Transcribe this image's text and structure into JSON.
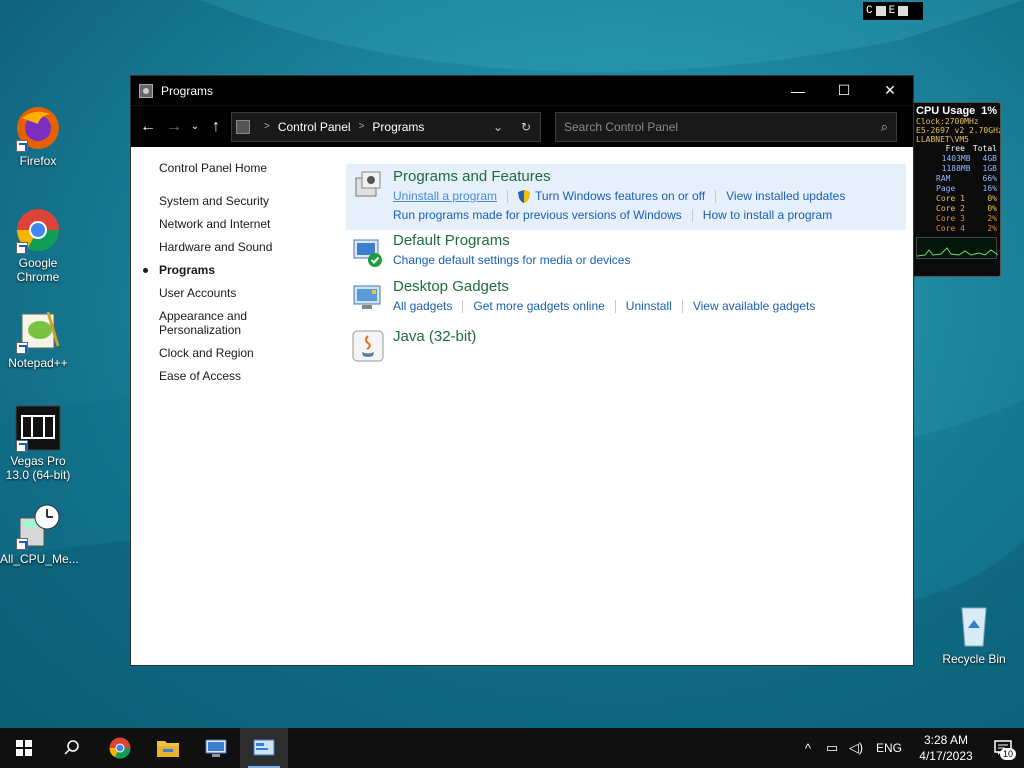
{
  "desktop": {
    "icons": [
      {
        "label": "Firefox"
      },
      {
        "label": "Google Chrome"
      },
      {
        "label": "Notepad++"
      },
      {
        "label": "Vegas Pro 13.0 (64-bit)"
      },
      {
        "label": "All_CPU_Me..."
      },
      {
        "label": "Recycle Bin"
      }
    ],
    "mini_box": {
      "c": "C",
      "e": "E"
    }
  },
  "gadget": {
    "title": "CPU Usage",
    "usage": "1%",
    "line1": "Clock:2700MHz",
    "line2": "E5-2697 v2 2.70GHz",
    "line3": "LLABNET\\VM5",
    "header_free": "Free",
    "header_total": "Total",
    "mem1_free": "1403MB",
    "mem1_total": "4GB",
    "mem2_free": "1188MB",
    "mem2_total": "1GB",
    "rows": [
      {
        "k": "RAM",
        "v": "66%"
      },
      {
        "k": "Page",
        "v": "16%"
      },
      {
        "k": "Core 1",
        "v": "0%"
      },
      {
        "k": "Core 2",
        "v": "0%"
      },
      {
        "k": "Core 3",
        "v": "2%"
      },
      {
        "k": "Core 4",
        "v": "2%"
      }
    ]
  },
  "window": {
    "title": "Programs",
    "buttons": {
      "minimize": "—",
      "maximize": "☐",
      "close": "✕"
    },
    "breadcrumb": [
      "Control Panel",
      "Programs"
    ],
    "search_placeholder": "Search Control Panel"
  },
  "leftnav": {
    "home": "Control Panel Home",
    "items": [
      {
        "label": "System and Security"
      },
      {
        "label": "Network and Internet"
      },
      {
        "label": "Hardware and Sound"
      },
      {
        "label": "Programs"
      },
      {
        "label": "User Accounts"
      },
      {
        "label": "Appearance and Personalization"
      },
      {
        "label": "Clock and Region"
      },
      {
        "label": "Ease of Access"
      }
    ]
  },
  "sections": {
    "programs_features": {
      "title": "Programs and Features",
      "links": [
        "Uninstall a program",
        "Turn Windows features on or off",
        "View installed updates",
        "Run programs made for previous versions of Windows",
        "How to install a program"
      ]
    },
    "default_programs": {
      "title": "Default Programs",
      "links": [
        "Change default settings for media or devices"
      ]
    },
    "desktop_gadgets": {
      "title": "Desktop Gadgets",
      "links": [
        "All gadgets",
        "Get more gadgets online",
        "Uninstall",
        "View available gadgets"
      ]
    },
    "java": {
      "title": "Java (32-bit)"
    }
  },
  "taskbar": {
    "lang": "ENG",
    "time": "3:28 AM",
    "date": "4/17/2023",
    "notifications": "10"
  }
}
